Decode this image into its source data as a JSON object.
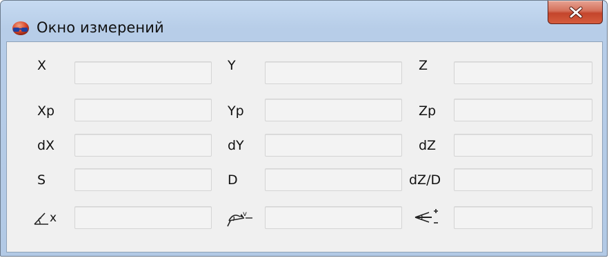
{
  "window": {
    "title": "Окно измерений",
    "close_label": "x"
  },
  "rows": [
    {
      "c1": {
        "label": "X",
        "value": ""
      },
      "c2": {
        "label": "Y",
        "value": ""
      },
      "c3": {
        "label": "Z",
        "value": ""
      }
    },
    {
      "c1": {
        "label": "Xp",
        "value": ""
      },
      "c2": {
        "label": "Yp",
        "value": ""
      },
      "c3": {
        "label": "Zp",
        "value": ""
      }
    },
    {
      "c1": {
        "label": "dX",
        "value": ""
      },
      "c2": {
        "label": "dY",
        "value": ""
      },
      "c3": {
        "label": "dZ",
        "value": ""
      }
    },
    {
      "c1": {
        "label": "S",
        "value": ""
      },
      "c2": {
        "label": "D",
        "value": ""
      },
      "c3": {
        "label": "dZ/D",
        "value": ""
      }
    }
  ],
  "icon_row": {
    "c1": {
      "icon": "angle-from-x-axis-icon",
      "label": "x",
      "value": ""
    },
    "c2": {
      "icon": "vertical-angle-icon",
      "value": ""
    },
    "c3": {
      "icon": "slope-plus-minus-icon",
      "value": ""
    }
  },
  "colors": {
    "titlebar": "#b7cde8",
    "client_bg": "#f0f0f0",
    "field_border": "#d4d4d4",
    "close_button": "#c4452c"
  }
}
